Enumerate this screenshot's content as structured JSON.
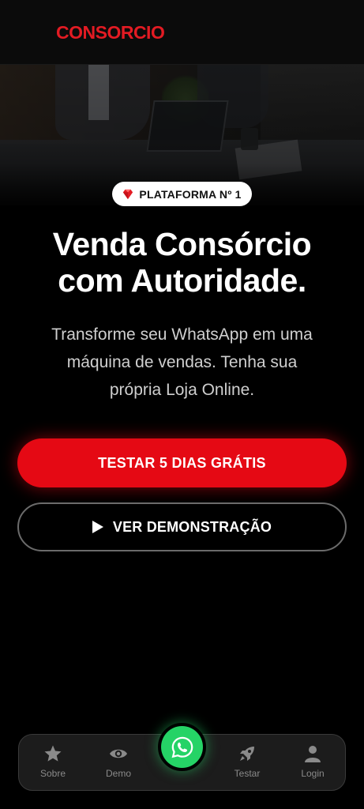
{
  "header": {
    "brand": "CONSORCIO"
  },
  "badge": {
    "icon": "gem-icon",
    "text": "PLATAFORMA Nº 1"
  },
  "hero": {
    "headline_line1": "Venda Consórcio",
    "headline_line2": "com Autoridade."
  },
  "subtitle": {
    "line1": "Transforme seu WhatsApp em uma",
    "line2": "máquina de vendas. Tenha sua",
    "line3": "própria Loja Online."
  },
  "cta": {
    "primary_label": "TESTAR 5 DIAS GRÁTIS",
    "secondary_label": "VER DEMONSTRAÇÃO"
  },
  "bottom_nav": {
    "items": [
      {
        "label": "Sobre",
        "icon": "star-icon"
      },
      {
        "label": "Demo",
        "icon": "eye-icon"
      },
      {
        "label": "Testar",
        "icon": "rocket-icon"
      },
      {
        "label": "Login",
        "icon": "user-icon"
      }
    ],
    "floating_button_icon": "whatsapp-icon"
  },
  "colors": {
    "brand_red": "#e31b23",
    "button_red": "#e50914",
    "whatsapp_green": "#25d366",
    "background": "#000000"
  }
}
